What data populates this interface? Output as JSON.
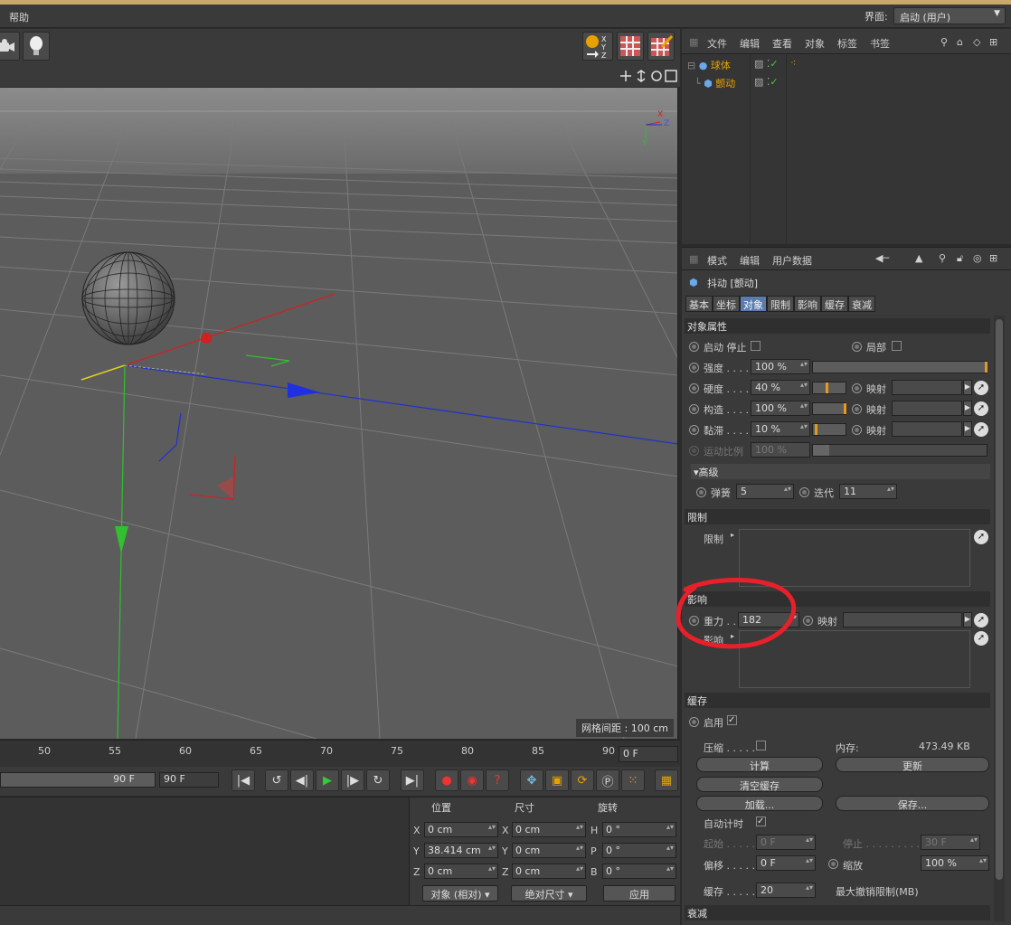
{
  "menubar": {
    "help": "帮助",
    "layout_label": "界面:",
    "layout_value": "启动 (用户)"
  },
  "viewport": {
    "grid_spacing": "网格间距 : 100 cm",
    "axis_x": "X",
    "axis_y": "Y",
    "axis_z": "Z"
  },
  "timeline": {
    "ticks": [
      "50",
      "55",
      "60",
      "65",
      "70",
      "75",
      "80",
      "85",
      "90"
    ],
    "current_frame": "0 F",
    "range_end_bar": "90 F",
    "range_end": "90 F"
  },
  "coords": {
    "headers": {
      "position": "位置",
      "size": "尺寸",
      "rotation": "旋转"
    },
    "pos": {
      "x_label": "X",
      "x": "0 cm",
      "y_label": "Y",
      "y": "38.414 cm",
      "z_label": "Z",
      "z": "0 cm"
    },
    "size": {
      "x_label": "X",
      "x": "0 cm",
      "y_label": "Y",
      "y": "0 cm",
      "z_label": "Z",
      "z": "0 cm"
    },
    "rot": {
      "h_label": "H",
      "h": "0 °",
      "p_label": "P",
      "p": "0 °",
      "b_label": "B",
      "b": "0 °"
    },
    "mode": "对象 (相对)",
    "size_mode": "绝对尺寸",
    "apply": "应用"
  },
  "object_manager": {
    "menu": [
      "文件",
      "编辑",
      "查看",
      "对象",
      "标签",
      "书签"
    ],
    "objects": [
      {
        "name": "球体"
      },
      {
        "name": "颤动"
      }
    ]
  },
  "attr_manager": {
    "menu": [
      "模式",
      "编辑",
      "用户数据"
    ],
    "title": "抖动 [颤动]",
    "tabs": [
      "基本",
      "坐标",
      "对象",
      "限制",
      "影响",
      "缓存",
      "衰减"
    ],
    "active_tab": "对象",
    "object_props": {
      "section": "对象属性",
      "start_stop": "启动 停止",
      "local": "局部",
      "strength_label": "强度 . . . .",
      "strength": "100 %",
      "hardness_label": "硬度 . . . .",
      "hardness": "40 %",
      "structure_label": "构造 . . . .",
      "structure": "100 %",
      "viscosity_label": "黏滞 . . . .",
      "viscosity": "10 %",
      "motion_label": "运动比例",
      "motion": "100 %",
      "map": "映射",
      "advanced": "高级",
      "spring_label": "弹簧",
      "spring": "5",
      "iter_label": "迭代",
      "iter": "11"
    },
    "limit": {
      "section": "限制",
      "label": "限制"
    },
    "influence": {
      "section": "影响",
      "gravity_label": "重力 . .",
      "gravity": "182",
      "map": "映射",
      "list_label": "影响"
    },
    "cache": {
      "section": "缓存",
      "enable": "启用",
      "compress": "压缩 . . . . .",
      "memory_label": "内存:",
      "memory": "473.49 KB",
      "calc": "计算",
      "update": "更新",
      "clear": "清空缓存",
      "load": "加载...",
      "save": "保存...",
      "auto_time": "自动计时",
      "start_label": "起始 . . . . .",
      "start": "0 F",
      "stop_label": "停止 . . . . . . . . .",
      "stop": "30 F",
      "offset_label": "偏移 . . . . .",
      "offset": "0 F",
      "scale_label": "缩放",
      "scale": "100 %",
      "cache_label": "缓存 . . . . .",
      "cache": "20",
      "undo_label": "最大撤销限制(MB)"
    },
    "falloff": "衰减"
  },
  "colors": {
    "accent": "#e39a1f",
    "tab_active": "#5a7ab0",
    "annotation": "#e8202a"
  }
}
